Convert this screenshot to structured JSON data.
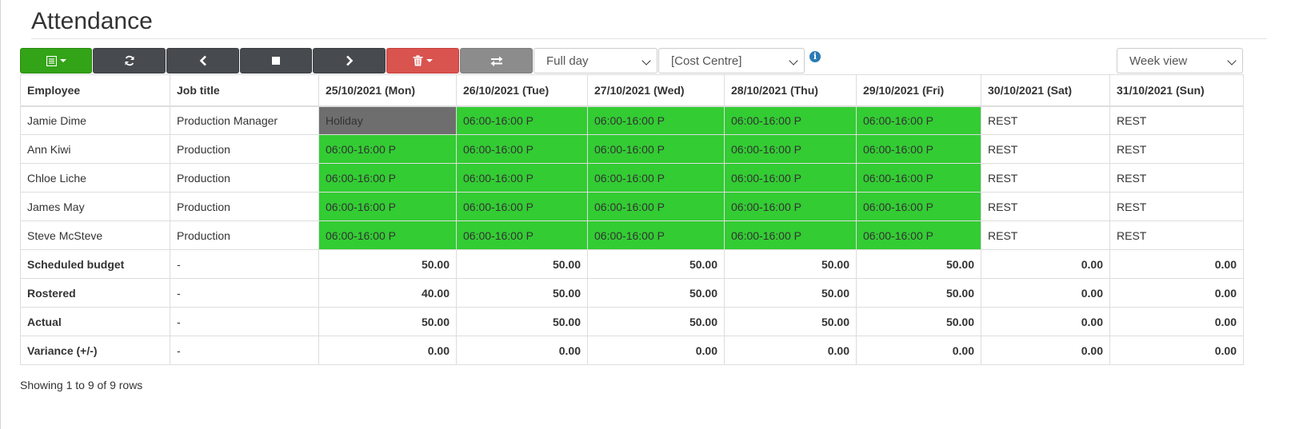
{
  "page": {
    "title": "Attendance"
  },
  "toolbar": {
    "buttons": [
      {
        "name": "menu-dropdown-button",
        "icon": "table-list-icon",
        "color": "#33a317"
      },
      {
        "name": "refresh-button",
        "icon": "refresh-icon",
        "color": "#474b4f"
      },
      {
        "name": "previous-button",
        "icon": "chevron-left-icon",
        "color": "#474b4f"
      },
      {
        "name": "stop-button",
        "icon": "stop-square-icon",
        "color": "#474b4f"
      },
      {
        "name": "next-button",
        "icon": "chevron-right-icon",
        "color": "#474b4f"
      },
      {
        "name": "delete-dropdown-button",
        "icon": "trash-icon",
        "color": "#d9534f"
      },
      {
        "name": "swap-button",
        "icon": "swap-arrows-icon",
        "color": "#8c8c8c"
      }
    ],
    "day_select": {
      "value": "Full day"
    },
    "cost_centre_select": {
      "value": "[Cost Centre]"
    },
    "view_select": {
      "value": "Week view"
    }
  },
  "table": {
    "columns": [
      "Employee",
      "Job title",
      "25/10/2021 (Mon)",
      "26/10/2021 (Tue)",
      "27/10/2021 (Wed)",
      "28/10/2021 (Thu)",
      "29/10/2021 (Fri)",
      "30/10/2021 (Sat)",
      "31/10/2021 (Sun)"
    ],
    "rows": [
      {
        "employee": "Jamie Dime",
        "job": "Production Manager",
        "days": [
          "Holiday",
          "06:00-16:00 P",
          "06:00-16:00 P",
          "06:00-16:00 P",
          "06:00-16:00 P",
          "REST",
          "REST"
        ]
      },
      {
        "employee": "Ann Kiwi",
        "job": "Production",
        "days": [
          "06:00-16:00 P",
          "06:00-16:00 P",
          "06:00-16:00 P",
          "06:00-16:00 P",
          "06:00-16:00 P",
          "REST",
          "REST"
        ]
      },
      {
        "employee": "Chloe Liche",
        "job": "Production",
        "days": [
          "06:00-16:00 P",
          "06:00-16:00 P",
          "06:00-16:00 P",
          "06:00-16:00 P",
          "06:00-16:00 P",
          "REST",
          "REST"
        ]
      },
      {
        "employee": "James May",
        "job": "Production",
        "days": [
          "06:00-16:00 P",
          "06:00-16:00 P",
          "06:00-16:00 P",
          "06:00-16:00 P",
          "06:00-16:00 P",
          "REST",
          "REST"
        ]
      },
      {
        "employee": "Steve McSteve",
        "job": "Production",
        "days": [
          "06:00-16:00 P",
          "06:00-16:00 P",
          "06:00-16:00 P",
          "06:00-16:00 P",
          "06:00-16:00 P",
          "REST",
          "REST"
        ]
      }
    ],
    "summary": [
      {
        "label": "Scheduled budget",
        "job": "-",
        "values": [
          "50.00",
          "50.00",
          "50.00",
          "50.00",
          "50.00",
          "0.00",
          "0.00"
        ]
      },
      {
        "label": "Rostered",
        "job": "-",
        "values": [
          "40.00",
          "50.00",
          "50.00",
          "50.00",
          "50.00",
          "0.00",
          "0.00"
        ]
      },
      {
        "label": "Actual",
        "job": "-",
        "values": [
          "50.00",
          "50.00",
          "50.00",
          "50.00",
          "50.00",
          "0.00",
          "0.00"
        ]
      },
      {
        "label": "Variance (+/-)",
        "job": "-",
        "values": [
          "0.00",
          "0.00",
          "0.00",
          "0.00",
          "0.00",
          "0.00",
          "0.00"
        ]
      }
    ]
  },
  "colors": {
    "shift": "#33cc33",
    "holiday": "#6e6e6e"
  },
  "footer": {
    "pagination_info": "Showing 1 to 9 of 9 rows"
  }
}
